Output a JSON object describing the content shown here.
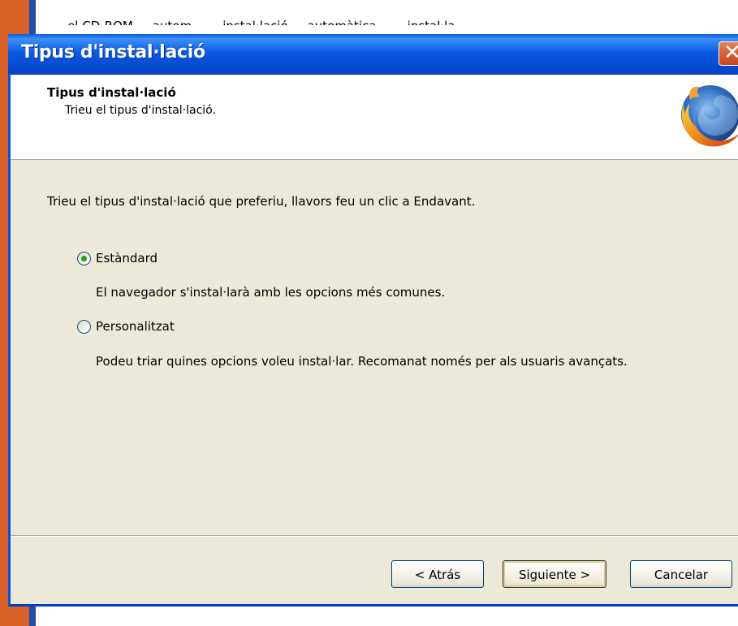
{
  "background": {
    "top_text": "... el CD-ROM ... autom... ... instal·lació ... automàtica... ... instal·la..."
  },
  "dialog": {
    "title": "Tipus d'instal·lació",
    "header": {
      "title": "Tipus d'instal·lació",
      "subtitle": "Trieu el tipus d'instal·lació."
    },
    "intro": "Trieu el tipus d'instal·lació que preferiu, llavors feu un clic a Endavant.",
    "options": [
      {
        "label": "Estàndard",
        "description": "El navegador s'instal·larà amb les opcions més comunes.",
        "selected": true
      },
      {
        "label": "Personalitzat",
        "description": "Podeu triar quines opcions voleu instal·lar. Recomanat només per als usuaris avançats.",
        "selected": false
      }
    ],
    "buttons": {
      "back": "< Atrás",
      "next": "Siguiente >",
      "cancel": "Cancelar"
    }
  },
  "colors": {
    "titlebar": "#0b5ce3",
    "dialog_bg": "#ece9d8",
    "radio_selected": "#21a121"
  },
  "icons": {
    "logo": "firefox-logo-icon",
    "close": "close-icon"
  }
}
